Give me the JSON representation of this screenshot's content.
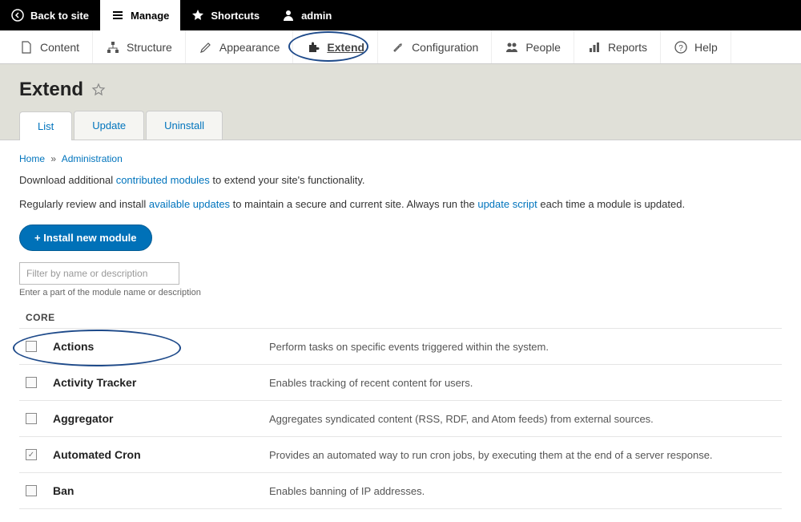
{
  "topbar": {
    "back": "Back to site",
    "manage": "Manage",
    "shortcuts": "Shortcuts",
    "user": "admin"
  },
  "adminmenu": {
    "content": "Content",
    "structure": "Structure",
    "appearance": "Appearance",
    "extend": "Extend",
    "configuration": "Configuration",
    "people": "People",
    "reports": "Reports",
    "help": "Help"
  },
  "page": {
    "title": "Extend"
  },
  "tabs": {
    "list": "List",
    "update": "Update",
    "uninstall": "Uninstall"
  },
  "breadcrumb": {
    "home": "Home",
    "admin": "Administration"
  },
  "intro": {
    "line1_a": "Download additional ",
    "line1_link": "contributed modules",
    "line1_b": " to extend your site's functionality.",
    "line2_a": "Regularly review and install ",
    "line2_link1": "available updates",
    "line2_b": " to maintain a secure and current site. Always run the ",
    "line2_link2": "update script",
    "line2_c": " each time a module is updated."
  },
  "install_button": "+ Install new module",
  "filter": {
    "placeholder": "Filter by name or description",
    "desc": "Enter a part of the module name or description"
  },
  "group_header": "CORE",
  "modules": [
    {
      "name": "Actions",
      "desc": "Perform tasks on specific events triggered within the system.",
      "checked": false
    },
    {
      "name": "Activity Tracker",
      "desc": "Enables tracking of recent content for users.",
      "checked": false
    },
    {
      "name": "Aggregator",
      "desc": "Aggregates syndicated content (RSS, RDF, and Atom feeds) from external sources.",
      "checked": false
    },
    {
      "name": "Automated Cron",
      "desc": "Provides an automated way to run cron jobs, by executing them at the end of a server response.",
      "checked": true
    },
    {
      "name": "Ban",
      "desc": "Enables banning of IP addresses.",
      "checked": false
    }
  ]
}
